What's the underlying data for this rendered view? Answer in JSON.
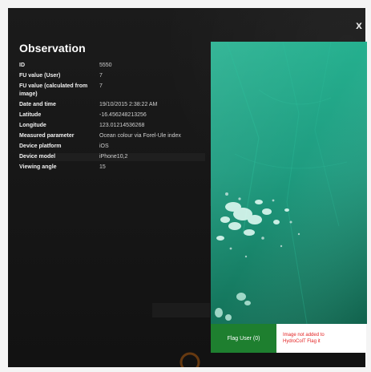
{
  "modal": {
    "title": "Observation",
    "close_label": "x",
    "fields": [
      {
        "label": "ID",
        "value": "5550"
      },
      {
        "label": "FU value (User)",
        "value": "7"
      },
      {
        "label": "FU value (calculated from image)",
        "value": "7"
      },
      {
        "label": "Date and time",
        "value": "19/10/2015 2:38:22 AM"
      },
      {
        "label": "Latitude",
        "value": "-16.456248213256"
      },
      {
        "label": "Longitude",
        "value": "123.01214536268"
      },
      {
        "label": "Measured parameter",
        "value": "Ocean colour via Forel-Ule index"
      },
      {
        "label": "Device platform",
        "value": "iOS"
      },
      {
        "label": "Device model",
        "value": "iPhone10,2"
      },
      {
        "label": "Viewing angle",
        "value": "15"
      }
    ],
    "footer": {
      "flag_button": "Flag User (0)",
      "note_line1": "Image not added to",
      "note_line2": "HydroColT Flag it"
    }
  },
  "colors": {
    "accent_green": "#1e7f2f",
    "warning_red": "#e32222",
    "panel_bg": "#151515",
    "photo_teal": "#1f9c80"
  }
}
